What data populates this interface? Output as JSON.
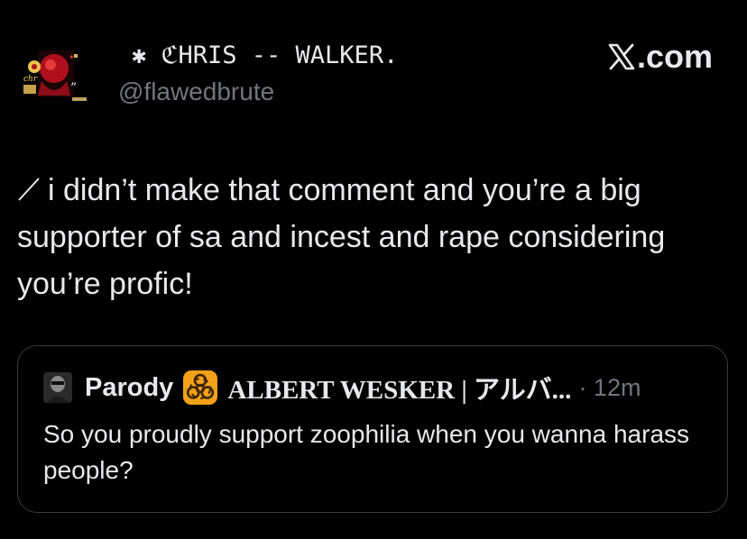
{
  "post": {
    "display_name": "✱ ℭHRIS -- WALKER.",
    "handle": "@flawedbrute",
    "brand_label": ".com",
    "text": "i didn’t make that comment and you’re a big supporter of sa and incest and rape considering you’re profic!",
    "prefix_icon": "slash-icon"
  },
  "quote": {
    "label": "Parody",
    "badge_icon": "biohazard-icon",
    "name": "ALBERT WESKER | アルバ...",
    "time": "· 12m",
    "text": "So you proudly support zoophilia when you wanna harass people?"
  },
  "colors": {
    "background": "#000000",
    "text": "#e7e9ea",
    "secondary": "#71767b",
    "border": "#3a3d41",
    "biohazard_bg": "#f4a11a",
    "avatar_red": "#c8102e"
  }
}
